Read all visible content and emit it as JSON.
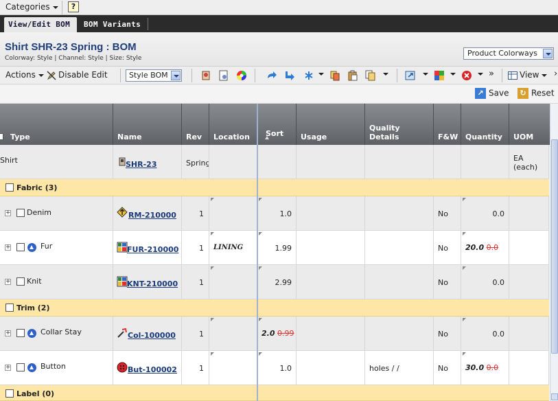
{
  "menu": {
    "categories": "Categories",
    "help": "?"
  },
  "tabs": [
    {
      "label": "View/Edit BOM",
      "active": true
    },
    {
      "label": "BOM Variants",
      "active": false
    }
  ],
  "header": {
    "title": "Shirt SHR-23 Spring : BOM",
    "subtitle": "Colorway: Style | Channel: Style | Size: Style",
    "colorways_select": "Product Colorways"
  },
  "toolbar": {
    "actions": "Actions",
    "disable_edit": "Disable Edit",
    "style_bom": "Style BOM",
    "view": "View",
    "more": "»"
  },
  "savebar": {
    "save": "Save",
    "reset": "Reset"
  },
  "columns": [
    "Type",
    "Name",
    "Rev",
    "Location",
    "Sort",
    "Usage",
    "Quality Details",
    "F&W",
    "Quantity",
    "UOM",
    "T"
  ],
  "rows": [
    {
      "kind": "item",
      "type": "Shirt",
      "name": "SHR-23",
      "rev": "Spring",
      "uom": "EA (each)"
    },
    {
      "kind": "group",
      "label": "Fabric (3)"
    },
    {
      "kind": "item",
      "type": "Denim",
      "name": "RM-210000",
      "rev": "1",
      "sort": "1.0",
      "fw": "No",
      "quantity": "0.0"
    },
    {
      "kind": "item",
      "type": "Fur",
      "name": "FUR-210000",
      "rev": "1",
      "location": "LINING",
      "sort": "1.99",
      "fw": "No",
      "quantity_new": "20.0",
      "quantity_old": "0.0"
    },
    {
      "kind": "item",
      "type": "Knit",
      "name": "KNT-210000",
      "rev": "1",
      "sort": "2.99",
      "fw": "No",
      "quantity": "0.0"
    },
    {
      "kind": "group",
      "label": "Trim (2)"
    },
    {
      "kind": "item",
      "type": "Collar Stay",
      "name": "Col-100000",
      "rev": "1",
      "sort_new": "2.0",
      "sort_old": "0.99",
      "fw": "No",
      "quantity": "0.0"
    },
    {
      "kind": "item",
      "type": "Button",
      "name": "But-100002",
      "rev": "1",
      "sort": "1.0",
      "quality": "holes / /",
      "fw": "No",
      "quantity_new": "30.0",
      "quantity_old": "0.0"
    },
    {
      "kind": "group",
      "label": "Label (0)"
    }
  ],
  "colors": {
    "tab_bar": "#2b2b2b",
    "group_row": "#fde6a6",
    "title": "#1f3f7a",
    "link": "#1a3a7a",
    "changed": "#dd3333"
  }
}
